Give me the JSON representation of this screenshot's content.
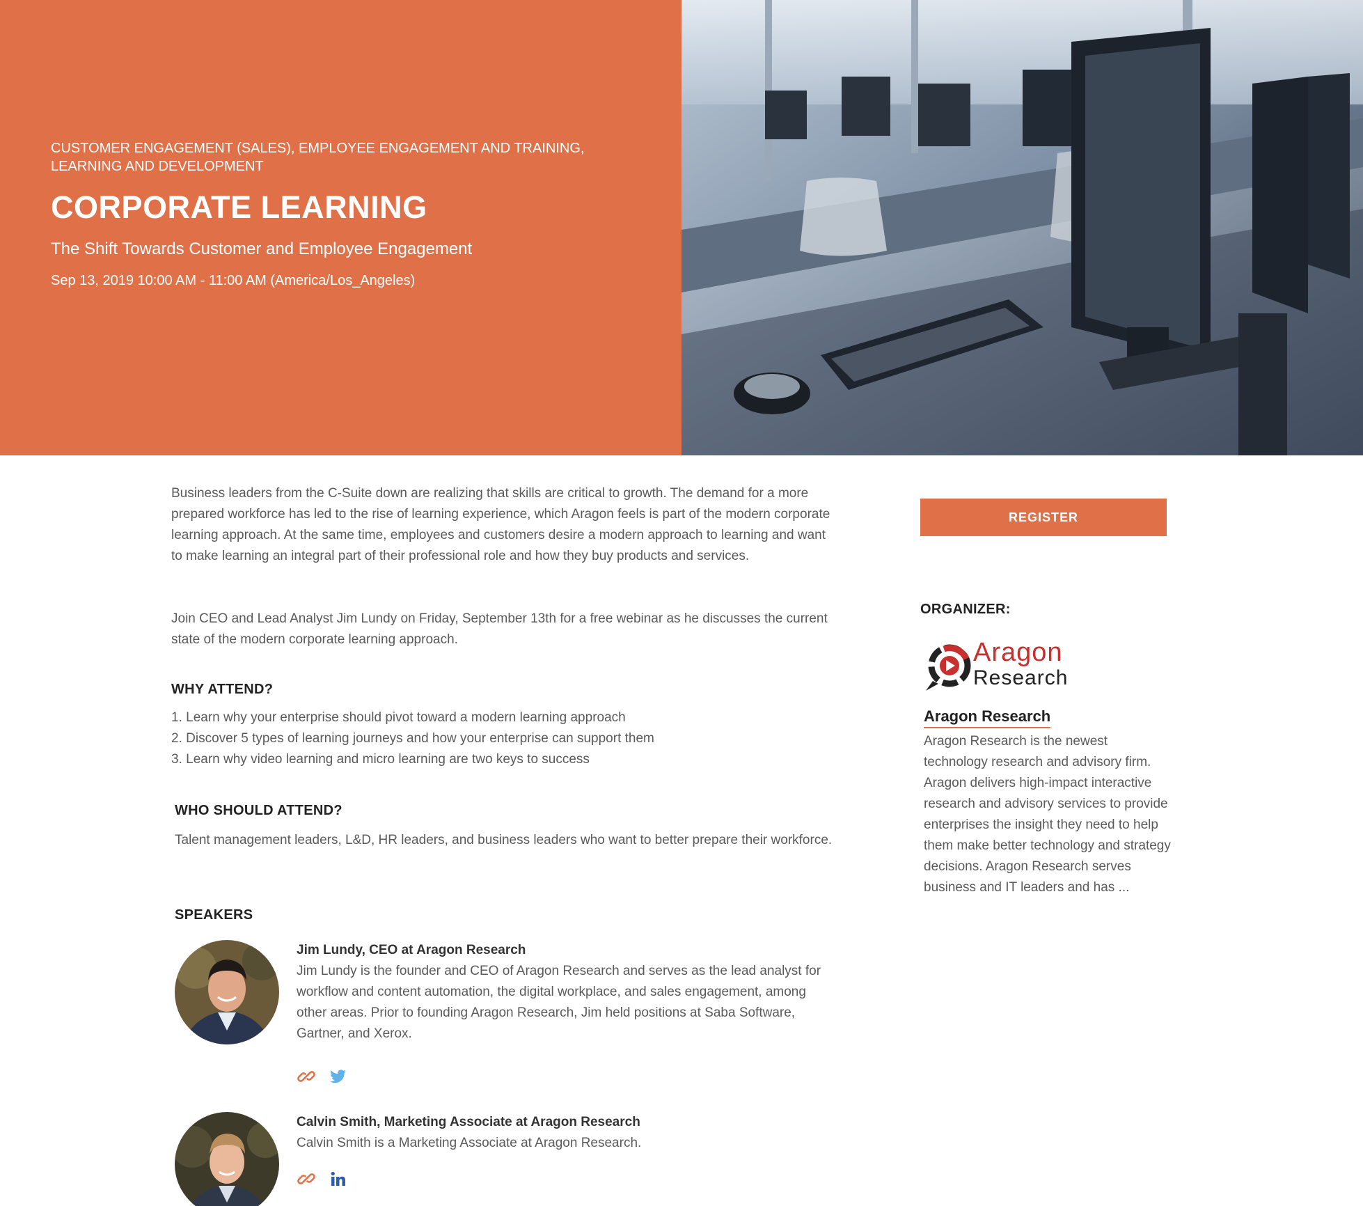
{
  "hero": {
    "categories": "CUSTOMER ENGAGEMENT (SALES), EMPLOYEE ENGAGEMENT AND TRAINING, LEARNING AND DEVELOPMENT",
    "title": "CORPORATE LEARNING",
    "subtitle": "The Shift Towards Customer and Employee Engagement",
    "datetime": "Sep 13, 2019 10:00 AM - 11:00 AM (America/Los_Angeles)",
    "accent_color": "#e07048"
  },
  "main": {
    "intro": "Business leaders from the C-Suite down are realizing that skills are critical to growth. The demand for a more prepared workforce has led to the rise of learning experience, which Aragon feels is part of the modern corporate learning approach. At the same time, employees and customers desire a modern approach to learning and want to make learning an integral part of their professional role and how they buy products and services.",
    "join": "Join CEO and Lead Analyst Jim Lundy on Friday, September 13th for a free webinar as he discusses the current state of the modern corporate learning approach.",
    "why_heading": "WHY ATTEND?",
    "why_items": [
      "1. Learn why your enterprise should pivot toward a modern learning approach",
      "2. Discover 5 types of learning journeys and how your enterprise can support them",
      "3. Learn why video learning and micro learning are two keys to success"
    ],
    "who_heading": "WHO SHOULD ATTEND?",
    "who_text": "Talent management leaders, L&D, HR leaders, and business leaders who want to better prepare their workforce.",
    "speakers_heading": "SPEAKERS",
    "speakers": [
      {
        "name": "Jim Lundy, CEO at Aragon Research",
        "bio": "Jim Lundy is the founder and CEO of Aragon Research and serves as the lead analyst for workflow and content automation, the digital workplace, and sales engagement, among other areas. Prior to founding Aragon Research, Jim held positions at Saba Software, Gartner, and Xerox.",
        "socials": [
          "link-icon",
          "twitter-icon"
        ]
      },
      {
        "name": "Calvin Smith, Marketing Associate at Aragon Research",
        "bio": "Calvin Smith is a Marketing Associate at Aragon Research.",
        "socials": [
          "link-icon",
          "linkedin-icon"
        ]
      }
    ]
  },
  "sidebar": {
    "register_label": "REGISTER",
    "organizer_label": "ORGANIZER:",
    "logo_line1": "Aragon",
    "logo_line2": "Research",
    "org_name": "Aragon Research",
    "org_desc": "Aragon Research is the newest technology research and advisory firm. Aragon delivers high-impact interactive research and advisory services to provide enterprises the insight they need to help them make better technology and strategy decisions. Aragon Research serves business and IT leaders and has ..."
  }
}
